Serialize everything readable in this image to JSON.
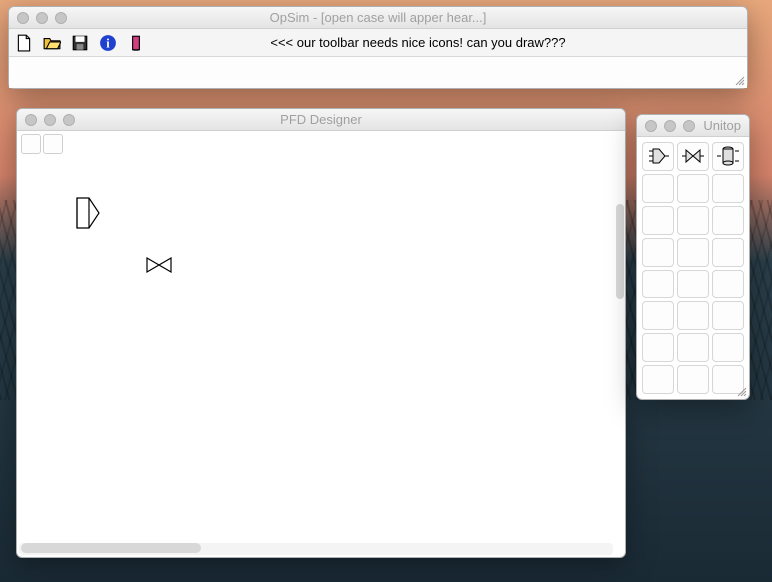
{
  "opsim": {
    "title": "OpSim - [open case will apper hear...]",
    "toolbar_message": "<<< our toolbar needs nice icons! can you draw???"
  },
  "pfd": {
    "title": "PFD Designer"
  },
  "unitop": {
    "title": "Unitop"
  }
}
